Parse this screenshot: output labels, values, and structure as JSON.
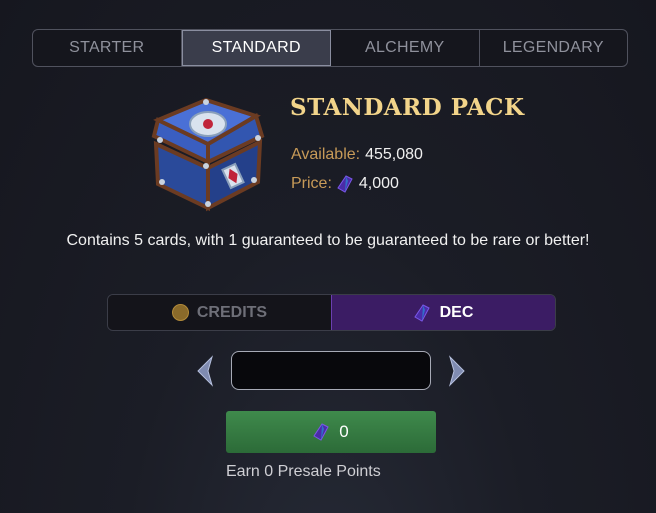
{
  "tabs": [
    {
      "label": "STARTER",
      "active": false
    },
    {
      "label": "STANDARD",
      "active": true
    },
    {
      "label": "ALCHEMY",
      "active": false
    },
    {
      "label": "LEGENDARY",
      "active": false
    }
  ],
  "pack": {
    "title": "STANDARD PACK",
    "available_label": "Available:",
    "available_value": "455,080",
    "price_label": "Price:",
    "price_value": "4,000",
    "price_icon": "dec-gem-icon",
    "image_icon": "treasure-chest-icon"
  },
  "description": "Contains 5 cards, with 1 guaranteed to be guaranteed to be rare or better!",
  "currency": {
    "credits_label": "CREDITS",
    "dec_label": "DEC",
    "selected": "DEC"
  },
  "quantity": {
    "value": "",
    "placeholder": ""
  },
  "buy_button": {
    "amount": "0"
  },
  "presale_text": "Earn 0 Presale Points",
  "colors": {
    "accent_gold": "#f2d48a",
    "label_gold": "#c79a58",
    "dec_purple": "#3b1c64",
    "buy_green": "#3f8a4c"
  }
}
